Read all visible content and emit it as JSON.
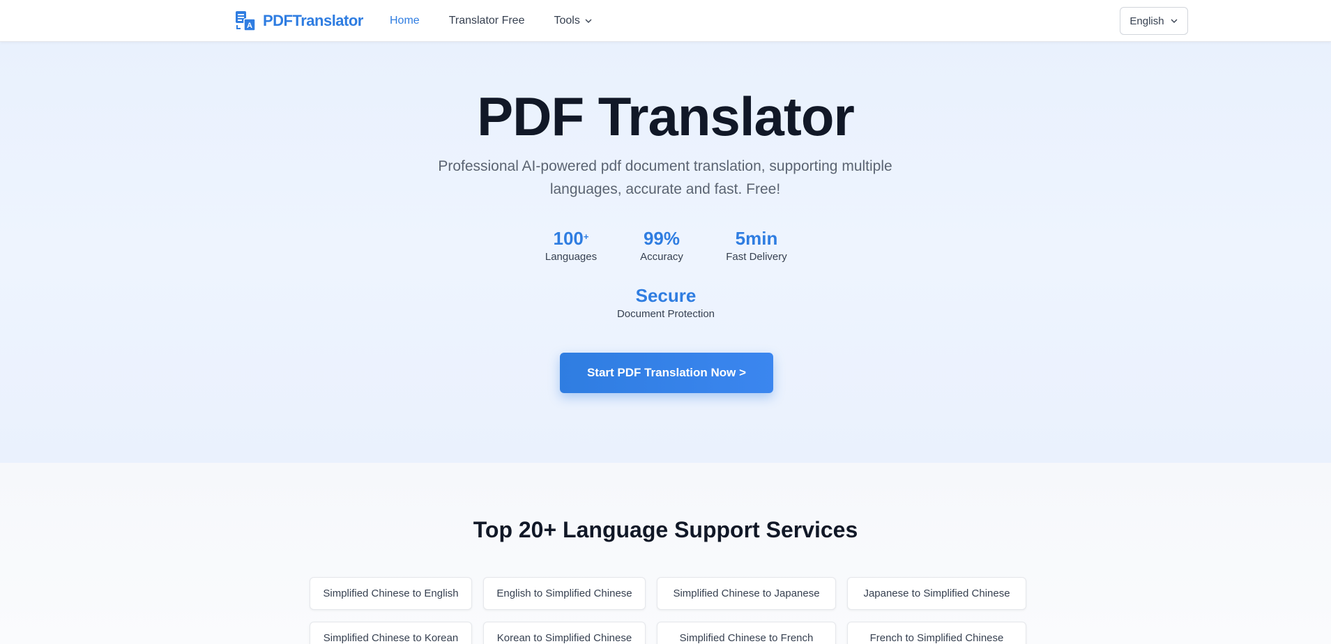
{
  "header": {
    "logo_text": "PDFTranslator",
    "nav": [
      {
        "label": "Home",
        "active": true
      },
      {
        "label": "Translator Free",
        "active": false
      },
      {
        "label": "Tools",
        "active": false,
        "has_dropdown": true
      }
    ],
    "language_selected": "English"
  },
  "hero": {
    "title": "PDF Translator",
    "subtitle": "Professional AI-powered pdf document translation, supporting multiple languages, accurate and fast. Free!",
    "stats": [
      {
        "value": "100",
        "suffix": "+",
        "label": "Languages"
      },
      {
        "value": "99%",
        "suffix": "",
        "label": "Accuracy"
      },
      {
        "value": "5min",
        "suffix": "",
        "label": "Fast Delivery"
      },
      {
        "value": "Secure",
        "suffix": "",
        "label": "Document Protection"
      }
    ],
    "cta_label": "Start PDF Translation Now >"
  },
  "services": {
    "title": "Top 20+ Language Support Services",
    "items": [
      "Simplified Chinese to English",
      "English to Simplified Chinese",
      "Simplified Chinese to Japanese",
      "Japanese to Simplified Chinese",
      "Simplified Chinese to Korean",
      "Korean to Simplified Chinese",
      "Simplified Chinese to French",
      "French to Simplified Chinese"
    ]
  },
  "colors": {
    "accent": "#2f7de1",
    "hero_bg": "#ebf2fd",
    "text_dark": "#111827",
    "text_muted": "#5b6472"
  },
  "icons": {
    "logo": "translate-document-icon",
    "dropdown": "chevron-down-icon"
  }
}
